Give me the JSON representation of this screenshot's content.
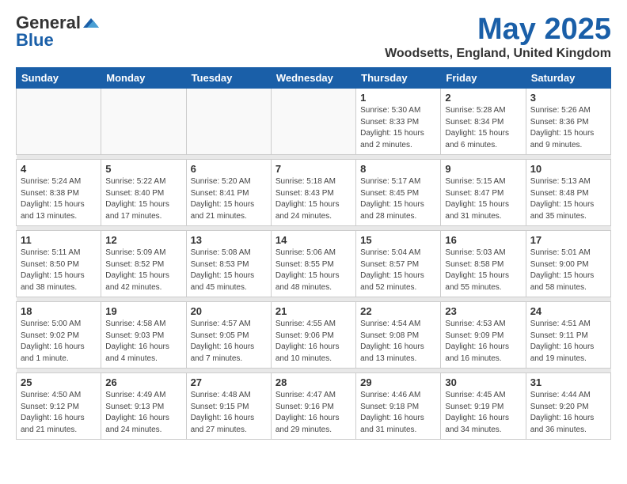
{
  "header": {
    "logo_general": "General",
    "logo_blue": "Blue",
    "month_title": "May 2025",
    "location": "Woodsetts, England, United Kingdom"
  },
  "days_of_week": [
    "Sunday",
    "Monday",
    "Tuesday",
    "Wednesday",
    "Thursday",
    "Friday",
    "Saturday"
  ],
  "weeks": [
    [
      {
        "num": "",
        "info": ""
      },
      {
        "num": "",
        "info": ""
      },
      {
        "num": "",
        "info": ""
      },
      {
        "num": "",
        "info": ""
      },
      {
        "num": "1",
        "info": "Sunrise: 5:30 AM\nSunset: 8:33 PM\nDaylight: 15 hours\nand 2 minutes."
      },
      {
        "num": "2",
        "info": "Sunrise: 5:28 AM\nSunset: 8:34 PM\nDaylight: 15 hours\nand 6 minutes."
      },
      {
        "num": "3",
        "info": "Sunrise: 5:26 AM\nSunset: 8:36 PM\nDaylight: 15 hours\nand 9 minutes."
      }
    ],
    [
      {
        "num": "4",
        "info": "Sunrise: 5:24 AM\nSunset: 8:38 PM\nDaylight: 15 hours\nand 13 minutes."
      },
      {
        "num": "5",
        "info": "Sunrise: 5:22 AM\nSunset: 8:40 PM\nDaylight: 15 hours\nand 17 minutes."
      },
      {
        "num": "6",
        "info": "Sunrise: 5:20 AM\nSunset: 8:41 PM\nDaylight: 15 hours\nand 21 minutes."
      },
      {
        "num": "7",
        "info": "Sunrise: 5:18 AM\nSunset: 8:43 PM\nDaylight: 15 hours\nand 24 minutes."
      },
      {
        "num": "8",
        "info": "Sunrise: 5:17 AM\nSunset: 8:45 PM\nDaylight: 15 hours\nand 28 minutes."
      },
      {
        "num": "9",
        "info": "Sunrise: 5:15 AM\nSunset: 8:47 PM\nDaylight: 15 hours\nand 31 minutes."
      },
      {
        "num": "10",
        "info": "Sunrise: 5:13 AM\nSunset: 8:48 PM\nDaylight: 15 hours\nand 35 minutes."
      }
    ],
    [
      {
        "num": "11",
        "info": "Sunrise: 5:11 AM\nSunset: 8:50 PM\nDaylight: 15 hours\nand 38 minutes."
      },
      {
        "num": "12",
        "info": "Sunrise: 5:09 AM\nSunset: 8:52 PM\nDaylight: 15 hours\nand 42 minutes."
      },
      {
        "num": "13",
        "info": "Sunrise: 5:08 AM\nSunset: 8:53 PM\nDaylight: 15 hours\nand 45 minutes."
      },
      {
        "num": "14",
        "info": "Sunrise: 5:06 AM\nSunset: 8:55 PM\nDaylight: 15 hours\nand 48 minutes."
      },
      {
        "num": "15",
        "info": "Sunrise: 5:04 AM\nSunset: 8:57 PM\nDaylight: 15 hours\nand 52 minutes."
      },
      {
        "num": "16",
        "info": "Sunrise: 5:03 AM\nSunset: 8:58 PM\nDaylight: 15 hours\nand 55 minutes."
      },
      {
        "num": "17",
        "info": "Sunrise: 5:01 AM\nSunset: 9:00 PM\nDaylight: 15 hours\nand 58 minutes."
      }
    ],
    [
      {
        "num": "18",
        "info": "Sunrise: 5:00 AM\nSunset: 9:02 PM\nDaylight: 16 hours\nand 1 minute."
      },
      {
        "num": "19",
        "info": "Sunrise: 4:58 AM\nSunset: 9:03 PM\nDaylight: 16 hours\nand 4 minutes."
      },
      {
        "num": "20",
        "info": "Sunrise: 4:57 AM\nSunset: 9:05 PM\nDaylight: 16 hours\nand 7 minutes."
      },
      {
        "num": "21",
        "info": "Sunrise: 4:55 AM\nSunset: 9:06 PM\nDaylight: 16 hours\nand 10 minutes."
      },
      {
        "num": "22",
        "info": "Sunrise: 4:54 AM\nSunset: 9:08 PM\nDaylight: 16 hours\nand 13 minutes."
      },
      {
        "num": "23",
        "info": "Sunrise: 4:53 AM\nSunset: 9:09 PM\nDaylight: 16 hours\nand 16 minutes."
      },
      {
        "num": "24",
        "info": "Sunrise: 4:51 AM\nSunset: 9:11 PM\nDaylight: 16 hours\nand 19 minutes."
      }
    ],
    [
      {
        "num": "25",
        "info": "Sunrise: 4:50 AM\nSunset: 9:12 PM\nDaylight: 16 hours\nand 21 minutes."
      },
      {
        "num": "26",
        "info": "Sunrise: 4:49 AM\nSunset: 9:13 PM\nDaylight: 16 hours\nand 24 minutes."
      },
      {
        "num": "27",
        "info": "Sunrise: 4:48 AM\nSunset: 9:15 PM\nDaylight: 16 hours\nand 27 minutes."
      },
      {
        "num": "28",
        "info": "Sunrise: 4:47 AM\nSunset: 9:16 PM\nDaylight: 16 hours\nand 29 minutes."
      },
      {
        "num": "29",
        "info": "Sunrise: 4:46 AM\nSunset: 9:18 PM\nDaylight: 16 hours\nand 31 minutes."
      },
      {
        "num": "30",
        "info": "Sunrise: 4:45 AM\nSunset: 9:19 PM\nDaylight: 16 hours\nand 34 minutes."
      },
      {
        "num": "31",
        "info": "Sunrise: 4:44 AM\nSunset: 9:20 PM\nDaylight: 16 hours\nand 36 minutes."
      }
    ]
  ]
}
